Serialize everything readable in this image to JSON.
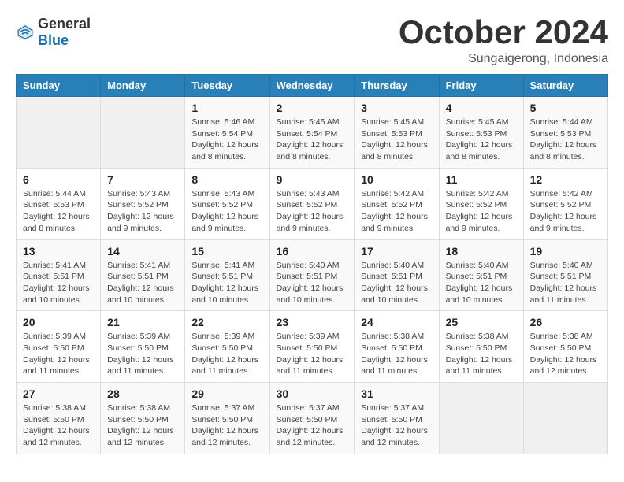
{
  "logo": {
    "general": "General",
    "blue": "Blue"
  },
  "title": {
    "month": "October 2024",
    "location": "Sungaigerong, Indonesia"
  },
  "weekdays": [
    "Sunday",
    "Monday",
    "Tuesday",
    "Wednesday",
    "Thursday",
    "Friday",
    "Saturday"
  ],
  "weeks": [
    [
      {
        "day": null
      },
      {
        "day": null
      },
      {
        "day": 1,
        "sunrise": "Sunrise: 5:46 AM",
        "sunset": "Sunset: 5:54 PM",
        "daylight": "Daylight: 12 hours and 8 minutes."
      },
      {
        "day": 2,
        "sunrise": "Sunrise: 5:45 AM",
        "sunset": "Sunset: 5:54 PM",
        "daylight": "Daylight: 12 hours and 8 minutes."
      },
      {
        "day": 3,
        "sunrise": "Sunrise: 5:45 AM",
        "sunset": "Sunset: 5:53 PM",
        "daylight": "Daylight: 12 hours and 8 minutes."
      },
      {
        "day": 4,
        "sunrise": "Sunrise: 5:45 AM",
        "sunset": "Sunset: 5:53 PM",
        "daylight": "Daylight: 12 hours and 8 minutes."
      },
      {
        "day": 5,
        "sunrise": "Sunrise: 5:44 AM",
        "sunset": "Sunset: 5:53 PM",
        "daylight": "Daylight: 12 hours and 8 minutes."
      }
    ],
    [
      {
        "day": 6,
        "sunrise": "Sunrise: 5:44 AM",
        "sunset": "Sunset: 5:53 PM",
        "daylight": "Daylight: 12 hours and 8 minutes."
      },
      {
        "day": 7,
        "sunrise": "Sunrise: 5:43 AM",
        "sunset": "Sunset: 5:52 PM",
        "daylight": "Daylight: 12 hours and 9 minutes."
      },
      {
        "day": 8,
        "sunrise": "Sunrise: 5:43 AM",
        "sunset": "Sunset: 5:52 PM",
        "daylight": "Daylight: 12 hours and 9 minutes."
      },
      {
        "day": 9,
        "sunrise": "Sunrise: 5:43 AM",
        "sunset": "Sunset: 5:52 PM",
        "daylight": "Daylight: 12 hours and 9 minutes."
      },
      {
        "day": 10,
        "sunrise": "Sunrise: 5:42 AM",
        "sunset": "Sunset: 5:52 PM",
        "daylight": "Daylight: 12 hours and 9 minutes."
      },
      {
        "day": 11,
        "sunrise": "Sunrise: 5:42 AM",
        "sunset": "Sunset: 5:52 PM",
        "daylight": "Daylight: 12 hours and 9 minutes."
      },
      {
        "day": 12,
        "sunrise": "Sunrise: 5:42 AM",
        "sunset": "Sunset: 5:52 PM",
        "daylight": "Daylight: 12 hours and 9 minutes."
      }
    ],
    [
      {
        "day": 13,
        "sunrise": "Sunrise: 5:41 AM",
        "sunset": "Sunset: 5:51 PM",
        "daylight": "Daylight: 12 hours and 10 minutes."
      },
      {
        "day": 14,
        "sunrise": "Sunrise: 5:41 AM",
        "sunset": "Sunset: 5:51 PM",
        "daylight": "Daylight: 12 hours and 10 minutes."
      },
      {
        "day": 15,
        "sunrise": "Sunrise: 5:41 AM",
        "sunset": "Sunset: 5:51 PM",
        "daylight": "Daylight: 12 hours and 10 minutes."
      },
      {
        "day": 16,
        "sunrise": "Sunrise: 5:40 AM",
        "sunset": "Sunset: 5:51 PM",
        "daylight": "Daylight: 12 hours and 10 minutes."
      },
      {
        "day": 17,
        "sunrise": "Sunrise: 5:40 AM",
        "sunset": "Sunset: 5:51 PM",
        "daylight": "Daylight: 12 hours and 10 minutes."
      },
      {
        "day": 18,
        "sunrise": "Sunrise: 5:40 AM",
        "sunset": "Sunset: 5:51 PM",
        "daylight": "Daylight: 12 hours and 10 minutes."
      },
      {
        "day": 19,
        "sunrise": "Sunrise: 5:40 AM",
        "sunset": "Sunset: 5:51 PM",
        "daylight": "Daylight: 12 hours and 11 minutes."
      }
    ],
    [
      {
        "day": 20,
        "sunrise": "Sunrise: 5:39 AM",
        "sunset": "Sunset: 5:50 PM",
        "daylight": "Daylight: 12 hours and 11 minutes."
      },
      {
        "day": 21,
        "sunrise": "Sunrise: 5:39 AM",
        "sunset": "Sunset: 5:50 PM",
        "daylight": "Daylight: 12 hours and 11 minutes."
      },
      {
        "day": 22,
        "sunrise": "Sunrise: 5:39 AM",
        "sunset": "Sunset: 5:50 PM",
        "daylight": "Daylight: 12 hours and 11 minutes."
      },
      {
        "day": 23,
        "sunrise": "Sunrise: 5:39 AM",
        "sunset": "Sunset: 5:50 PM",
        "daylight": "Daylight: 12 hours and 11 minutes."
      },
      {
        "day": 24,
        "sunrise": "Sunrise: 5:38 AM",
        "sunset": "Sunset: 5:50 PM",
        "daylight": "Daylight: 12 hours and 11 minutes."
      },
      {
        "day": 25,
        "sunrise": "Sunrise: 5:38 AM",
        "sunset": "Sunset: 5:50 PM",
        "daylight": "Daylight: 12 hours and 11 minutes."
      },
      {
        "day": 26,
        "sunrise": "Sunrise: 5:38 AM",
        "sunset": "Sunset: 5:50 PM",
        "daylight": "Daylight: 12 hours and 12 minutes."
      }
    ],
    [
      {
        "day": 27,
        "sunrise": "Sunrise: 5:38 AM",
        "sunset": "Sunset: 5:50 PM",
        "daylight": "Daylight: 12 hours and 12 minutes."
      },
      {
        "day": 28,
        "sunrise": "Sunrise: 5:38 AM",
        "sunset": "Sunset: 5:50 PM",
        "daylight": "Daylight: 12 hours and 12 minutes."
      },
      {
        "day": 29,
        "sunrise": "Sunrise: 5:37 AM",
        "sunset": "Sunset: 5:50 PM",
        "daylight": "Daylight: 12 hours and 12 minutes."
      },
      {
        "day": 30,
        "sunrise": "Sunrise: 5:37 AM",
        "sunset": "Sunset: 5:50 PM",
        "daylight": "Daylight: 12 hours and 12 minutes."
      },
      {
        "day": 31,
        "sunrise": "Sunrise: 5:37 AM",
        "sunset": "Sunset: 5:50 PM",
        "daylight": "Daylight: 12 hours and 12 minutes."
      },
      {
        "day": null
      },
      {
        "day": null
      }
    ]
  ]
}
